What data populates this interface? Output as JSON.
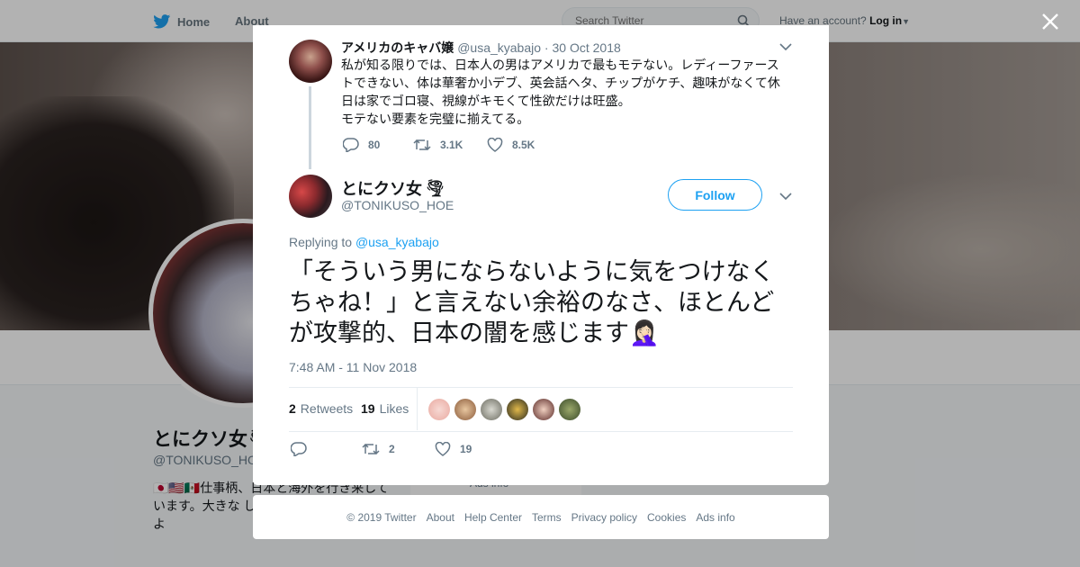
{
  "topbar": {
    "home_label": "Home",
    "about_label": "About",
    "search_placeholder": "Search Twitter",
    "account_prompt": "Have an account?",
    "login_label": "Log in"
  },
  "profile": {
    "name": "とにクソ女🌪",
    "handle": "@TONIKUSO_HO",
    "bio": "🇯🇵🇺🇸🇲🇽仕事柄、日本と海外を行き来しています。大きな しています◎日本 ックスよ",
    "ads_info": "Ads info"
  },
  "parent_tweet": {
    "name": "アメリカのキャバ嬢",
    "handle": "@usa_kyabajo",
    "sep": "·",
    "date": "30 Oct 2018",
    "text": "私が知る限りでは、日本人の男はアメリカで最もモテない。レディーファーストできない、体は華奢か小デブ、英会話ヘタ、チップがケチ、趣味がなくて休日は家でゴロ寝、視線がキモくて性欲だけは旺盛。\nモテない要素を完璧に揃えてる。",
    "replies": "80",
    "retweets": "3.1K",
    "likes": "8.5K"
  },
  "main_tweet": {
    "name": "とにクソ女",
    "name_emoji": "🌪",
    "handle": "@TONIKUSO_HOE",
    "follow_label": "Follow",
    "replying_to_label": "Replying to",
    "replying_to_handle": "@usa_kyabajo",
    "text": "「そういう男にならないように気をつけなくちゃね！」と言えない余裕のなさ、ほとんどが攻撃的、日本の闇を感じます🤦🏻‍♀️",
    "timestamp": "7:48 AM - 11 Nov 2018",
    "retweets_count": "2",
    "retweets_label": "Retweets",
    "likes_count": "19",
    "likes_label": "Likes",
    "action_retweets": "2",
    "action_likes": "19"
  },
  "footer": {
    "copyright": "© 2019 Twitter",
    "links": [
      "About",
      "Help Center",
      "Terms",
      "Privacy policy",
      "Cookies",
      "Ads info"
    ]
  },
  "colors": {
    "accent": "#1da1f2",
    "muted": "#657786",
    "text": "#14171a"
  }
}
